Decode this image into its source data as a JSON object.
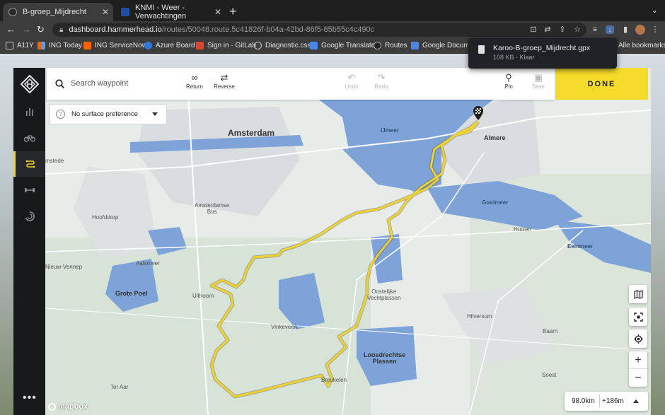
{
  "browser": {
    "tabs": [
      {
        "title": "B-groep_Mijdrecht",
        "active": true
      },
      {
        "title": "KNMI - Weer - Verwachtingen",
        "active": false
      }
    ],
    "url_host": "dashboard.hammerhead.io",
    "url_path": "/routes/50048.route.5c41826f-b04a-42bd-86f5-85b55c4c490c",
    "bookmarks": [
      "A11Y",
      "ING Today",
      "ING ServiceNow",
      "Azure Board",
      "Sign in · GitLab",
      "Diagnostic.css",
      "Google Translate",
      "Routes",
      "Google Document"
    ],
    "all_bookmarks_label": "Alle bookmarks",
    "download": {
      "filename": "Karoo-B-groep_Mijdrecht.gpx",
      "meta": "108 KB · Klaar"
    }
  },
  "toolbar": {
    "search_placeholder": "Search waypoint",
    "return_label": "Return",
    "reverse_label": "Reverse",
    "undo_label": "Undo",
    "redo_label": "Redo",
    "pin_label": "Pin",
    "save_label": "Save",
    "done_label": "DONE"
  },
  "surface": {
    "selected": "No surface preference"
  },
  "stats": {
    "distance": "98.0km",
    "elevation": "+186m"
  },
  "map": {
    "attribution": "mapbox",
    "labels": {
      "amsterdam": "Amsterdam",
      "almere": "Almere",
      "ijmeer": "IJmeer",
      "gooimeer": "Gooimeer",
      "eemmeer": "Eemmeer",
      "huizen": "Huizen",
      "hoofddorp": "Hoofddorp",
      "amstelveen": "Amstelveen",
      "amsterdamse_bos": "Amsterdamse\nBos",
      "zwanenburg": "nenburg",
      "nieuw_vennep": "Nieuw-Vennep",
      "aalsmeer": "Aalsmeer",
      "grote_poel": "Grote Poel",
      "uithoorn": "Uithoorn",
      "vinkeveen": "Vinkeveen",
      "oostelijke": "Oostelijke\nVechtplassen",
      "hilversum": "Hilversum",
      "baarn": "Baarn",
      "loosdrechtse": "Loosdrechtse\nPlassen",
      "breukelen": "Breukelen",
      "soest": "Soest",
      "ter_aar": "Ter Aar",
      "mstede": "mstede"
    }
  },
  "colors": {
    "accent": "#f5dc2a",
    "route": "#f1d22c",
    "water": "#7ea3d8",
    "sidebar": "#18191b"
  }
}
